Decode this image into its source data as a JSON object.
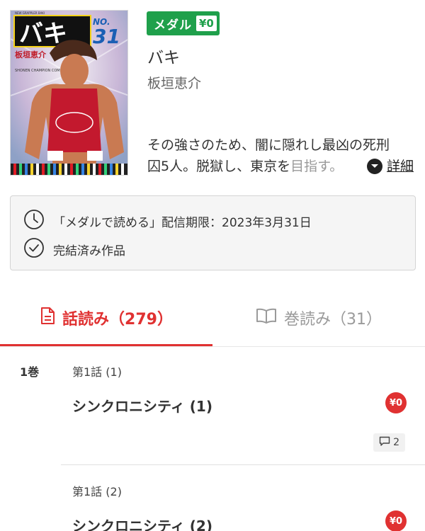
{
  "book": {
    "cover_alt": "バキ 31",
    "cover_title": "バキ",
    "cover_volume": "31",
    "cover_no": "NO.",
    "cover_small": "NEW GRAPPLER BAKI",
    "cover_author": "板垣恵介",
    "cover_publisher": "SHONEN CHAMPION COMICS",
    "medal_label": "メダル",
    "medal_price": "¥0",
    "title": "バキ",
    "author": "板垣恵介",
    "description_line1": "その強さのため、闇に隠れし最凶の死刑",
    "description_line2_a": "囚5人。脱獄し、東京を",
    "description_line2_b": "目指す。",
    "detail_label": "詳細"
  },
  "info": {
    "period_text": "「メダルで読める」配信期限：2023年3月31日",
    "completed_text": "完結済み作品"
  },
  "tabs": [
    {
      "label": "話読み（279）",
      "active": true
    },
    {
      "label": "巻読み（31）",
      "active": false
    }
  ],
  "list": {
    "volume_label": "1巻",
    "episodes": [
      {
        "sub": "第1話 (1)",
        "title": "シンクロニシティ (1)",
        "price": "¥0",
        "comments": "2"
      },
      {
        "sub": "第1話 (2)",
        "title": "シンクロニシティ (2)",
        "price": "¥0"
      }
    ]
  },
  "colors": {
    "accent": "#e03131",
    "medal_green": "#1fa04b"
  }
}
